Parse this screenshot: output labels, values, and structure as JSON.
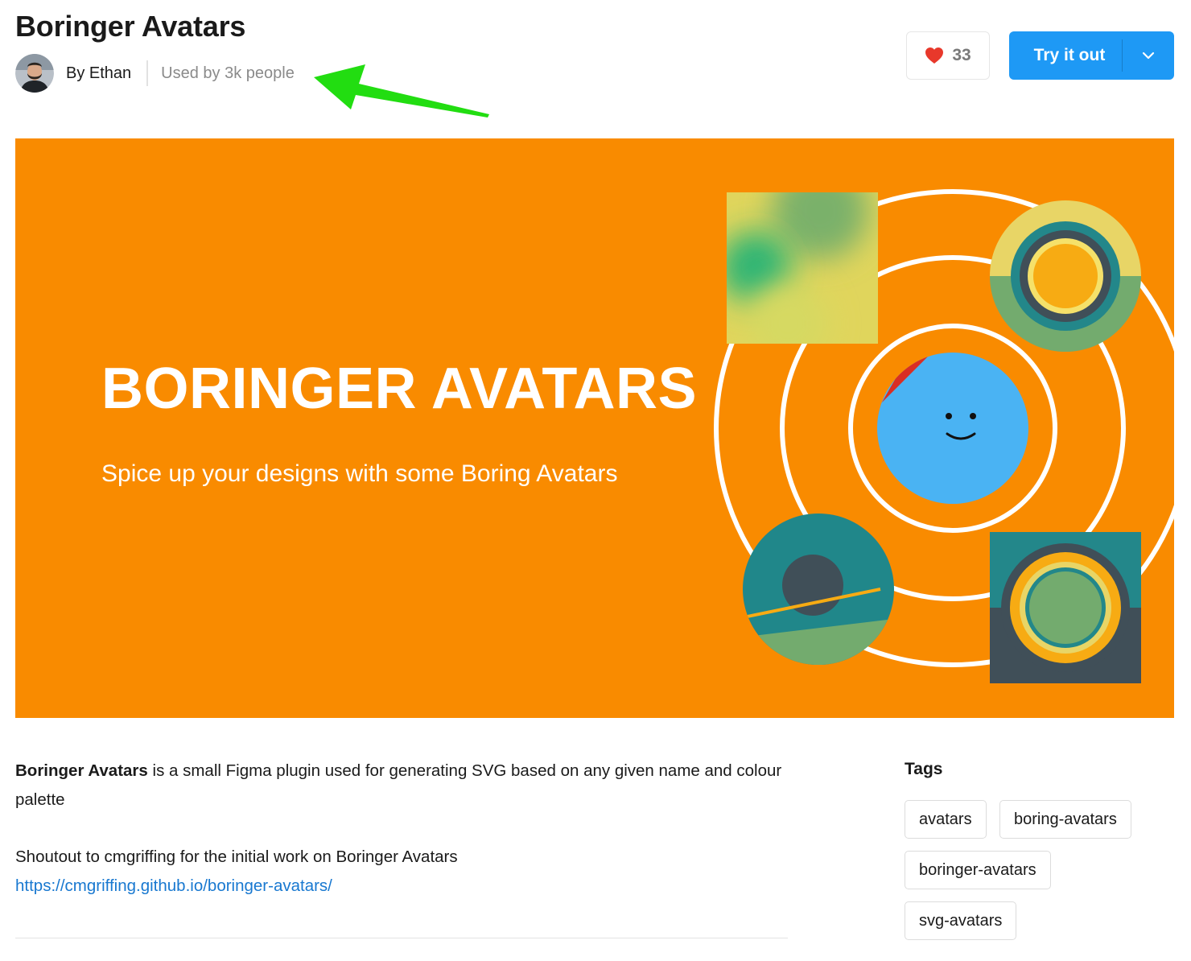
{
  "header": {
    "title": "Boringer Avatars",
    "author_label": "By Ethan",
    "usage_label": "Used by 3k people",
    "avatar_icon": "user-avatar-photo"
  },
  "actions": {
    "like_icon": "heart-icon",
    "like_count": "33",
    "try_label": "Try it out",
    "try_dropdown_icon": "chevron-down-icon"
  },
  "hero": {
    "title": "BORINGER AVATARS",
    "subtitle": "Spice up your designs with some Boring Avatars",
    "background_color": "#f98b00"
  },
  "description": {
    "bold_name": "Boringer Avatars",
    "text": " is a small Figma plugin used for generating SVG based on any given name and colour palette",
    "shoutout": "Shoutout to cmgriffing for the initial work on Boringer Avatars",
    "link": "https://cmgriffing.github.io/boringer-avatars/"
  },
  "tags": {
    "heading": "Tags",
    "items": [
      "avatars",
      "boring-avatars",
      "boringer-avatars",
      "svg-avatars"
    ]
  },
  "annotation": {
    "arrow_color": "#22dd11"
  },
  "colors": {
    "primary_button": "#1e99f5",
    "heart": "#e8382b",
    "link": "#1878d0"
  }
}
